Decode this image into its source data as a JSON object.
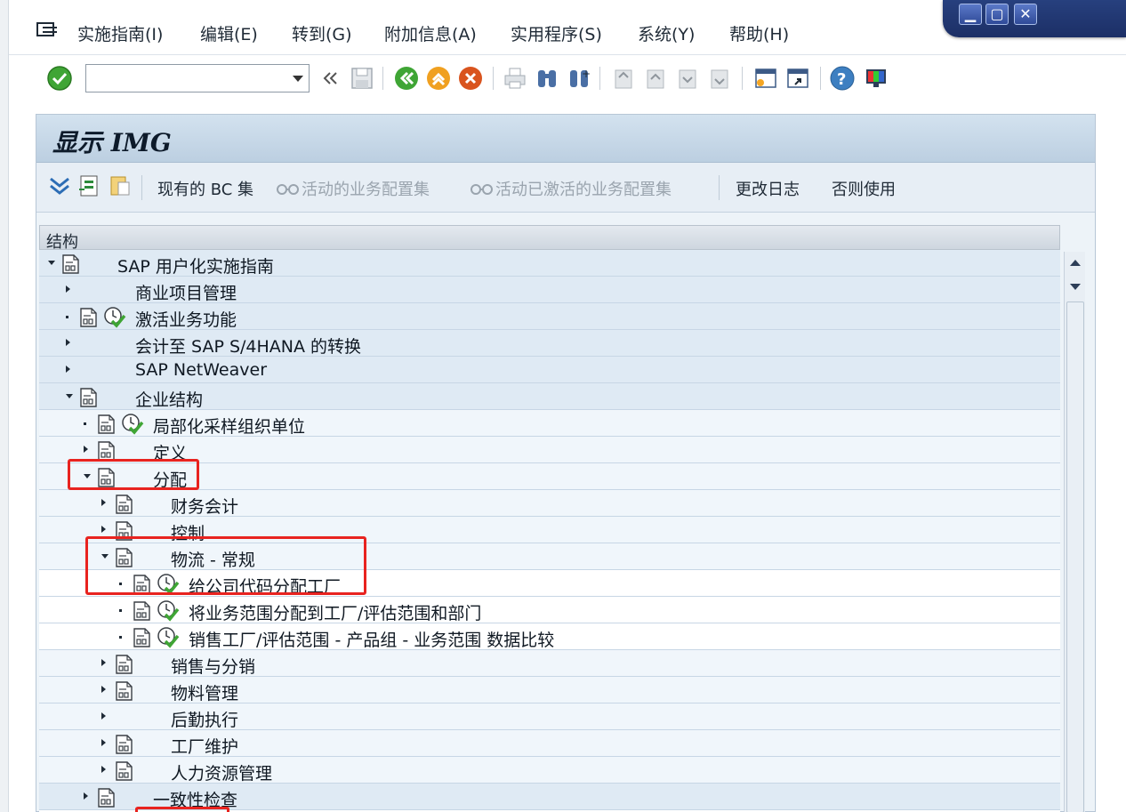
{
  "menu": {
    "items": [
      "实施指南(I)",
      "编辑(E)",
      "转到(G)",
      "附加信息(A)",
      "实用程序(S)",
      "系统(Y)",
      "帮助(H)"
    ]
  },
  "window_controls": {
    "minimize": "▁",
    "maximize": "▢",
    "close": "✕"
  },
  "toolbar": {
    "command_value": "",
    "icons": [
      "check-icon",
      "back-arrows-icon",
      "save-icon",
      "back-icon",
      "exit-icon",
      "cancel-icon",
      "print-icon",
      "find-icon",
      "find-next-icon",
      "first-page-icon",
      "prev-page-icon",
      "next-page-icon",
      "last-page-icon",
      "new-session-icon",
      "shortcut-icon",
      "help-icon",
      "customize-layout-icon"
    ]
  },
  "page": {
    "title": "显示 IMG"
  },
  "app_toolbar": {
    "bc_sets": "现有的 BC 集",
    "active_config_sets": "活动的业务配置集",
    "activated_config_sets": "活动已激活的业务配置集",
    "change_log": "更改日志",
    "otherwise_use": "否则使用"
  },
  "tree": {
    "header": "结构",
    "rows": [
      {
        "label": "SAP 用户化实施指南",
        "level": 0,
        "state": "open",
        "doc": true,
        "act": false
      },
      {
        "label": "商业项目管理",
        "level": 1,
        "state": "closed",
        "doc": false,
        "act": false
      },
      {
        "label": "激活业务功能",
        "level": 1,
        "state": "leaf",
        "doc": true,
        "act": true
      },
      {
        "label": "会计至 SAP S/4HANA 的转换",
        "level": 1,
        "state": "closed",
        "doc": false,
        "act": false
      },
      {
        "label": "SAP NetWeaver",
        "level": 1,
        "state": "closed",
        "doc": false,
        "act": false
      },
      {
        "label": "企业结构",
        "level": 1,
        "state": "open",
        "doc": true,
        "act": false
      },
      {
        "label": "局部化采样组织单位",
        "level": 2,
        "state": "leaf",
        "doc": true,
        "act": true
      },
      {
        "label": "定义",
        "level": 2,
        "state": "closed",
        "doc": true,
        "act": false
      },
      {
        "label": "分配",
        "level": 2,
        "state": "open",
        "doc": true,
        "act": false
      },
      {
        "label": "财务会计",
        "level": 3,
        "state": "closed",
        "doc": true,
        "act": false
      },
      {
        "label": "控制",
        "level": 3,
        "state": "closed",
        "doc": true,
        "act": false
      },
      {
        "label": "物流 - 常规",
        "level": 3,
        "state": "open",
        "doc": true,
        "act": false
      },
      {
        "label": "给公司代码分配工厂",
        "level": 4,
        "state": "leaf",
        "doc": true,
        "act": true
      },
      {
        "label": "将业务范围分配到工厂/评估范围和部门",
        "level": 4,
        "state": "leaf",
        "doc": true,
        "act": true
      },
      {
        "label": "销售工厂/评估范围 - 产品组 - 业务范围 数据比较",
        "level": 4,
        "state": "leaf",
        "doc": true,
        "act": true
      },
      {
        "label": "销售与分销",
        "level": 3,
        "state": "closed",
        "doc": true,
        "act": false
      },
      {
        "label": "物料管理",
        "level": 3,
        "state": "closed",
        "doc": true,
        "act": false
      },
      {
        "label": "后勤执行",
        "level": 3,
        "state": "closed",
        "doc": false,
        "act": false
      },
      {
        "label": "工厂维护",
        "level": 3,
        "state": "closed",
        "doc": true,
        "act": false
      },
      {
        "label": "人力资源管理",
        "level": 3,
        "state": "closed",
        "doc": true,
        "act": false
      },
      {
        "label": "一致性检查",
        "level": 2,
        "state": "closed",
        "doc": true,
        "act": false
      }
    ]
  },
  "colors": {
    "highlight_box": "#e8231f",
    "accent": "#27407e"
  }
}
